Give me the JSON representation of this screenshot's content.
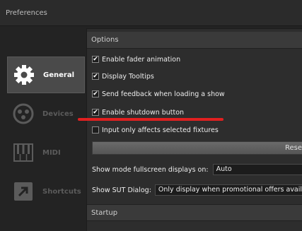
{
  "window": {
    "title": "Preferences"
  },
  "sidebar": {
    "items": [
      {
        "label": "General",
        "icon": "gear-icon",
        "active": true
      },
      {
        "label": "Devices",
        "icon": "devices-icon",
        "active": false
      },
      {
        "label": "MIDI",
        "icon": "piano-keys-icon",
        "active": false
      },
      {
        "label": "Shortcuts",
        "icon": "shortcut-arrow-icon",
        "active": false
      }
    ]
  },
  "options": {
    "header": "Options",
    "checkboxes": [
      {
        "label": "Enable fader animation",
        "checked": true
      },
      {
        "label": "Display Tooltips",
        "checked": true
      },
      {
        "label": "Send feedback when loading a show",
        "checked": true
      },
      {
        "label": "Enable shutdown button",
        "checked": true
      },
      {
        "label": "Input only affects selected fixtures",
        "checked": false
      }
    ],
    "check_mark": "✔",
    "reset_label": "Rese",
    "fullscreen": {
      "label": "Show mode fullscreen displays on:",
      "value": "Auto"
    },
    "sut_dialog": {
      "label": "Show SUT Dialog:",
      "value": "Only display when promotional offers availa"
    }
  },
  "startup": {
    "header": "Startup"
  },
  "colors": {
    "annotation": "#e02020",
    "active_bg": "#4a4a4a"
  }
}
